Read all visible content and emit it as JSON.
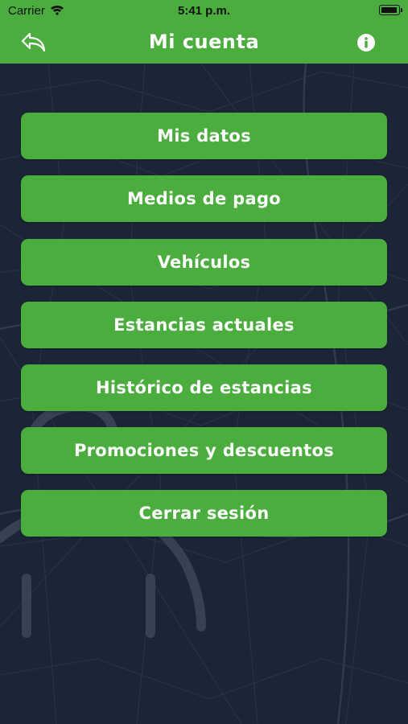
{
  "status_bar": {
    "carrier": "Carrier",
    "time": "5:41 p.m.",
    "battery_level": 1.0
  },
  "header": {
    "title": "Mi cuenta",
    "back_icon": "back-arrow-icon",
    "info_icon": "info-icon"
  },
  "colors": {
    "brand_green": "#4aad3d",
    "background": "#1b2536",
    "map_lines": "#2a3547"
  },
  "menu": {
    "items": [
      {
        "label": "Mis datos"
      },
      {
        "label": "Medios de pago"
      },
      {
        "label": "Vehículos"
      },
      {
        "label": "Estancias actuales"
      },
      {
        "label": "Histórico de estancias"
      },
      {
        "label": "Promociones y descuentos"
      },
      {
        "label": "Cerrar sesión"
      }
    ]
  }
}
